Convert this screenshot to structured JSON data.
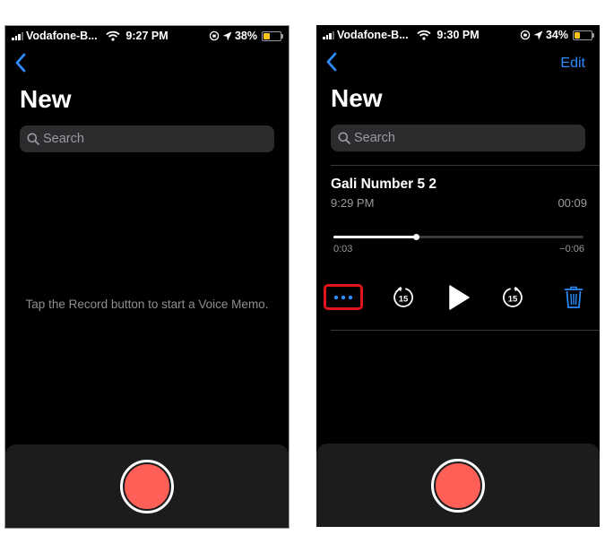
{
  "colors": {
    "accent_blue": "#2f8cff",
    "record_red": "#fe5f57",
    "highlight_red": "#e0151b",
    "battery_yellow": "#f5c518"
  },
  "left_screen": {
    "status": {
      "carrier": "Vodafone-B...",
      "time": "9:27 PM",
      "battery": "38%",
      "battery_level": 0.38
    },
    "title": "New",
    "search": {
      "placeholder": "Search"
    },
    "empty_message": "Tap the Record button to start a Voice Memo.",
    "icons": [
      "back-chevron-icon",
      "search-icon",
      "wifi-icon",
      "location-arrow-icon",
      "orientation-lock-icon"
    ]
  },
  "right_screen": {
    "status": {
      "carrier": "Vodafone-B...",
      "time": "9:30 PM",
      "battery": "34%",
      "battery_level": 0.34
    },
    "nav": {
      "edit_label": "Edit"
    },
    "title": "New",
    "search": {
      "placeholder": "Search"
    },
    "memo": {
      "name": "Gali Number 5 2",
      "date": "9:29 PM",
      "duration": "00:09",
      "elapsed": "0:03",
      "remaining": "−0:06",
      "progress": 0.3333
    },
    "controls": {
      "skip_back_seconds": "15",
      "skip_forward_seconds": "15",
      "icons": [
        "more-options-icon",
        "skip-back-15-icon",
        "play-icon",
        "skip-forward-15-icon",
        "trash-icon"
      ]
    }
  }
}
